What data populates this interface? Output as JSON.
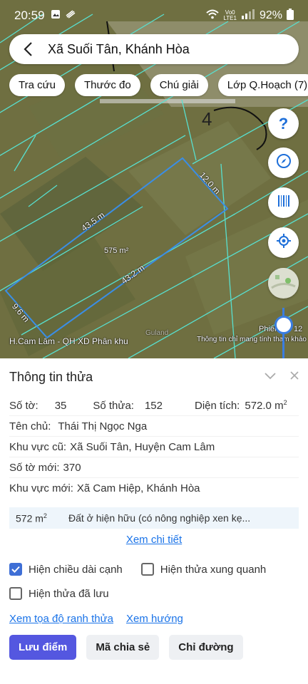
{
  "status": {
    "time": "20:59",
    "net_top": "Vo0",
    "net_bottom": "LTE1",
    "battery": "92%"
  },
  "search": {
    "title": "Xã Suối Tân, Khánh Hòa"
  },
  "chips": [
    {
      "label": "Tra cứu"
    },
    {
      "label": "Thước đo"
    },
    {
      "label": "Chú giải"
    },
    {
      "label": "Lớp Q.Hoạch (7)"
    }
  ],
  "map": {
    "parcel_area": "575 m²",
    "edge_top": "43.5 m",
    "edge_right": "12.0 m",
    "edge_bottom": "43.2 m",
    "edge_left": "9.6 m",
    "layer_label": "H.Cam Lâm - QH XD Phân khu",
    "notice": "Thông tin chỉ mang tính tham khảo",
    "version_prefix": "Phiên",
    "version_suffix": "12",
    "parcel_number": "4",
    "watermark": "Guland"
  },
  "panel": {
    "title": "Thông tin thửa",
    "so_to_label": "Số tờ:",
    "so_to": "35",
    "so_thua_label": "Số thửa:",
    "so_thua": "152",
    "dien_tich_label": "Diện tích:",
    "dien_tich": "572.0 m",
    "dien_tich_sup": "2",
    "ten_chu_label": "Tên chủ:",
    "ten_chu": "Thái Thị Ngọc Nga",
    "kv_cu_label": "Khu vực cũ:",
    "kv_cu": "Xã Suối Tân, Huyện Cam Lâm",
    "so_to_moi_label": "Số tờ mới:",
    "so_to_moi": "370",
    "kv_moi_label": "Khu vực mới:",
    "kv_moi": "Xã Cam Hiệp, Khánh Hòa",
    "landuse_area": "572 m",
    "landuse_area_sup": "2",
    "landuse_desc": "Đất ở hiện hữu (có nông nghiệp xen kẹ...",
    "detail_link": "Xem chi tiết",
    "cb_show_edges": "Hiện chiều dài cạnh",
    "cb_show_edges_checked": true,
    "cb_neighbors": "Hiện thửa xung quanh",
    "cb_saved": "Hiện thửa đã lưu",
    "link_coords": "Xem tọa độ ranh thửa",
    "link_direction": "Xem hướng",
    "btn_save": "Lưu điểm",
    "btn_share": "Mã chia sẻ",
    "btn_route": "Chỉ đường"
  },
  "colors": {
    "accent": "#5457e0",
    "link": "#1a73e8",
    "parcel_outline": "#3a8ee6",
    "grid_lines": "#58e0cf"
  }
}
